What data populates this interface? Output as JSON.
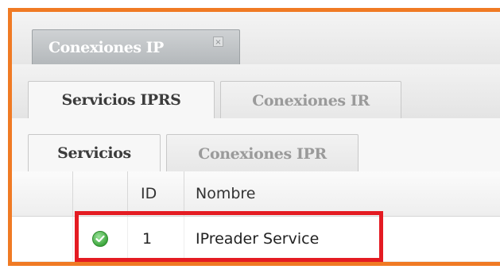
{
  "window_tab": {
    "label": "Conexiones IP",
    "close_glyph": "×",
    "accent_color": "#f07a24"
  },
  "level2_tabs": [
    {
      "label": "Servicios IPRS",
      "active": true
    },
    {
      "label": "Conexiones IR",
      "active": false
    }
  ],
  "level3_tabs": [
    {
      "label": "Servicios",
      "active": true
    },
    {
      "label": "Conexiones IPR",
      "active": false
    }
  ],
  "grid": {
    "columns": [
      "",
      "",
      "ID",
      "Nombre"
    ],
    "rows": [
      {
        "status_icon": "check-circle-icon",
        "status_color": "#3ea73e",
        "id": "1",
        "nombre": "IPreader Service"
      }
    ],
    "highlight_color": "#e41b22"
  }
}
